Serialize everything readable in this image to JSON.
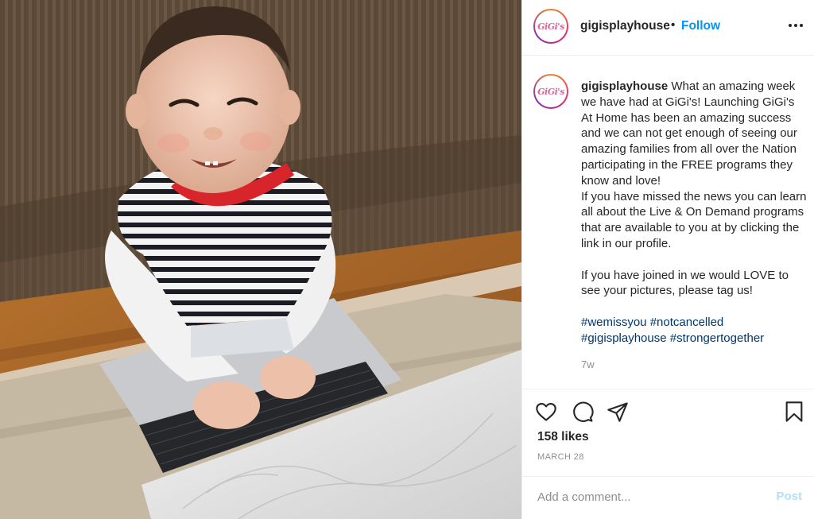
{
  "post": {
    "image_alt": "Smiling toddler in a striped shirt typing on a marble-covered laptop",
    "author": {
      "username": "gigisplayhouse",
      "avatar_logo_text": "GiGi's",
      "follow_label": "Follow",
      "separator": "•"
    },
    "more_icon": "more-horizontal-icon",
    "caption": {
      "username": "gigisplayhouse",
      "text": " What an amazing week we have had at GiGi's! Launching GiGi's At Home has been an amazing success and we can not get enough of seeing our amazing families from all over the Nation participating in the FREE programs they know and love!\nIf you have missed the news you can learn all about the Live & On Demand programs that are available to you at by clicking the link in our profile.\n\nIf you have joined in we would LOVE to see your pictures, please tag us!",
      "hashtags": [
        "#wemissyou",
        "#notcancelled",
        "#gigisplayhouse",
        "#strongertogether"
      ]
    },
    "time_ago": "7w",
    "actions": {
      "like_icon": "heart-icon",
      "comment_icon": "comment-icon",
      "share_icon": "paper-plane-icon",
      "save_icon": "bookmark-icon"
    },
    "likes_text": "158 likes",
    "date": "MARCH 28",
    "comment_box": {
      "placeholder": "Add a comment...",
      "value": "",
      "post_label": "Post"
    },
    "colors": {
      "link_blue": "#0095f6",
      "hashtag_blue": "#00376b",
      "post_disabled": "#b2dffc",
      "muted_text": "#8e8e8e"
    }
  }
}
